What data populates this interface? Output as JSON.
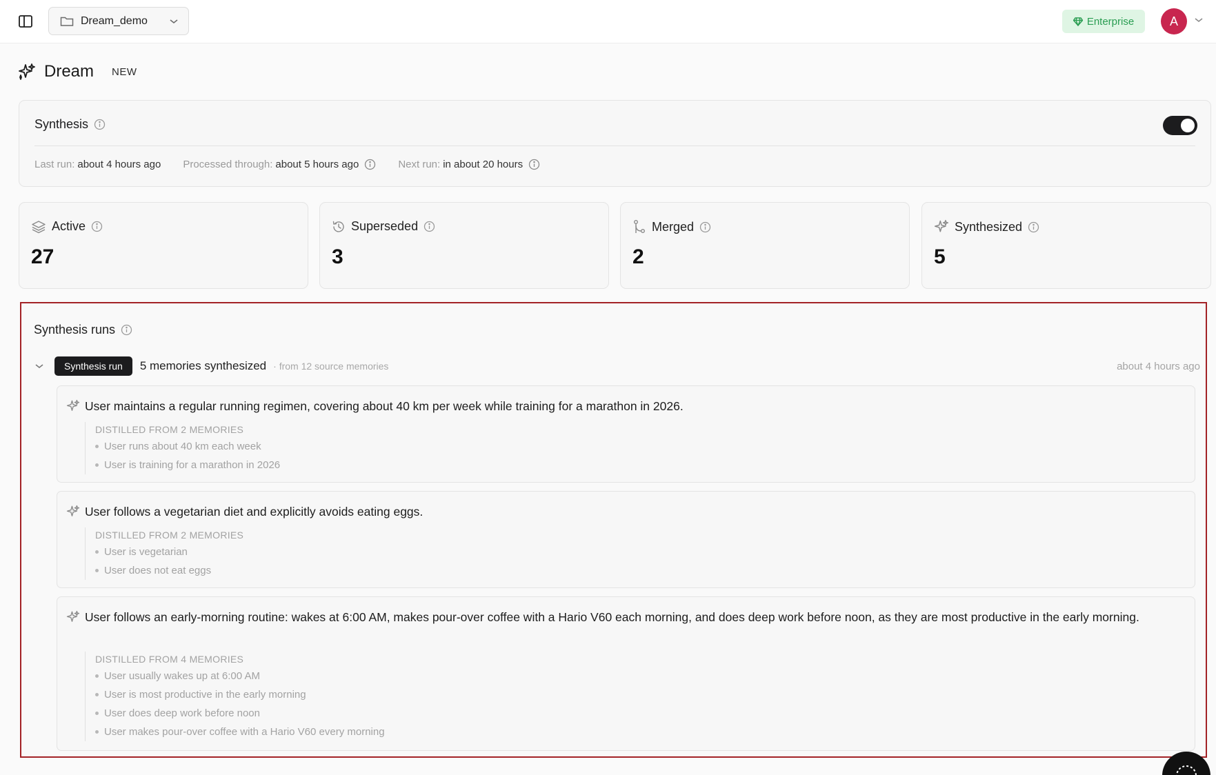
{
  "topbar": {
    "project_name": "Dream_demo",
    "enterprise_label": "Enterprise",
    "avatar_initial": "A"
  },
  "page": {
    "title": "Dream",
    "tag": "NEW"
  },
  "synthesis": {
    "title": "Synthesis",
    "enabled": true,
    "last_run_label": "Last run:",
    "last_run_value": "about 4 hours ago",
    "processed_label": "Processed through:",
    "processed_value": "about 5 hours ago",
    "next_run_label": "Next run:",
    "next_run_value": "in about 20 hours"
  },
  "stats": [
    {
      "label": "Active",
      "value": "27",
      "icon": "layers-icon"
    },
    {
      "label": "Superseded",
      "value": "3",
      "icon": "history-icon"
    },
    {
      "label": "Merged",
      "value": "2",
      "icon": "merge-icon"
    },
    {
      "label": "Synthesized",
      "value": "5",
      "icon": "sparkles-icon"
    }
  ],
  "runs": {
    "title": "Synthesis runs",
    "run": {
      "badge": "Synthesis run",
      "summary": "5 memories synthesized",
      "source": "· from 12 source memories",
      "time": "about 4 hours ago"
    },
    "memories": [
      {
        "text": "User maintains a regular running regimen, covering about 40 km per week while training for a marathon in 2026.",
        "distilled_label": "DISTILLED FROM 2 MEMORIES",
        "sources": [
          "User runs about 40 km each week",
          "User is training for a marathon in 2026"
        ]
      },
      {
        "text": "User follows a vegetarian diet and explicitly avoids eating eggs.",
        "distilled_label": "DISTILLED FROM 2 MEMORIES",
        "sources": [
          "User is vegetarian",
          "User does not eat eggs"
        ]
      },
      {
        "text": "User follows an early-morning routine: wakes at 6:00 AM, makes pour-over coffee with a Hario V60 each morning, and does deep work before noon, as they are most productive in the early morning.",
        "distilled_label": "DISTILLED FROM 4 MEMORIES",
        "sources": [
          "User usually wakes up at 6:00 AM",
          "User is most productive in the early morning",
          "User does deep work before noon",
          "User makes pour-over coffee with a Hario V60 every morning"
        ]
      }
    ]
  },
  "colors": {
    "accent_dark": "#1c1c1e",
    "enterprise_bg": "#dff5e4",
    "enterprise_text": "#2a9d52",
    "avatar_bg": "#c8264f",
    "highlight_border": "#a32226"
  }
}
